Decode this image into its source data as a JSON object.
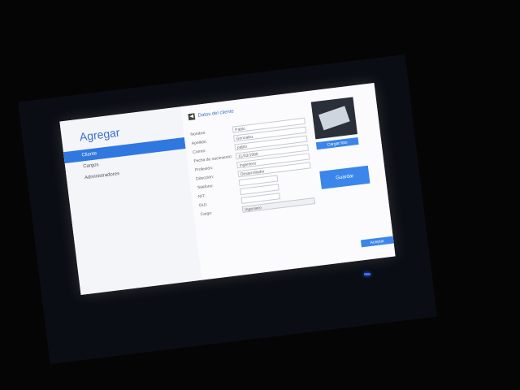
{
  "app": {
    "title": "Agregar"
  },
  "sidebar": {
    "items": [
      {
        "label": "Cliente",
        "active": true
      },
      {
        "label": "Cargos",
        "active": false
      },
      {
        "label": "Administradores",
        "active": false
      }
    ]
  },
  "content": {
    "back_label": "Datos del cliente",
    "fields": [
      {
        "label": "Nombre:",
        "value": "Pablo",
        "type": "text"
      },
      {
        "label": "Apellido:",
        "value": "Gonzalez",
        "type": "text"
      },
      {
        "label": "Correo:",
        "value": "pablo",
        "type": "text"
      },
      {
        "label": "Fecha de nacimiento:",
        "value": "11/03/1988",
        "type": "text"
      },
      {
        "label": "Profesión:",
        "value": "Ingeniero",
        "type": "text"
      },
      {
        "label": "Dirección:",
        "value": "Desarrollador",
        "type": "text"
      },
      {
        "label": "Teléfono:",
        "value": "",
        "type": "small"
      },
      {
        "label": "NIT:",
        "value": "",
        "type": "small"
      },
      {
        "label": "DUI:",
        "value": "",
        "type": "small"
      },
      {
        "label": "Cargo:",
        "value": "Ingeniero",
        "type": "select"
      }
    ],
    "load_button": "Cargar foto",
    "save_button": "Guardar",
    "ok_button": "Aceptar"
  },
  "colors": {
    "accent": "#2f78e0",
    "title": "#3a6fd0"
  }
}
